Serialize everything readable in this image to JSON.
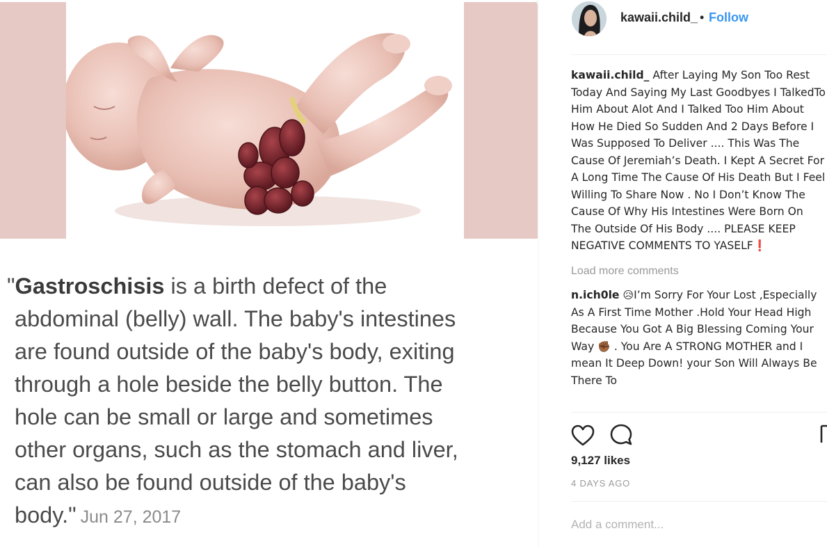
{
  "post": {
    "quote_word": "Gastroschisis",
    "quote_lines": [
      " is a birth defect of the",
      "abdominal (belly) wall. The baby's intestines",
      "are found outside of the baby's body, exiting",
      "through a hole beside the belly button. The",
      "hole can be small or large and sometimes",
      "other organs, such as the stomach and liver,",
      "can also be found outside of the baby's",
      "body.\""
    ],
    "quote_open": "\"",
    "quote_date": "Jun 27, 2017"
  },
  "header": {
    "username": "kawaii.child_",
    "separator": "•",
    "follow_label": "Follow"
  },
  "comments": {
    "caption": {
      "author": "kawaii.child_",
      "text": "After Laying My Son Too Rest Today And Saying My Last Goodbyes I TalkedTo Him About Alot And I Talked Too Him About How He Died So Sudden And 2 Days Before I Was Supposed To Deliver .... This Was The Cause Of Jeremiah’s Death. I Kept A Secret For A Long Time The Cause Of His Death But I Feel Willing To Share Now . No I Don’t Know The Cause Of Why His Intestines Were Born On The Outside Of His Body .... PLEASE KEEP NEGATIVE COMMENTS TO YASELF",
      "end_mark": "❗"
    },
    "load_more_label": "Load more comments",
    "items": [
      {
        "author": "n.ich0le",
        "emoji_1": "😥",
        "text_1": "I’m Sorry For Your Lost ,Especially As A First Time Mother .Hold Your Head High Because You Got A Big Blessing Coming Your Way ",
        "emoji_2": "✊🏾",
        "text_2": " . You Are A STRONG MOTHER and I mean It Deep Down! your Son Will Always Be There To"
      }
    ]
  },
  "actions": {
    "like_icon": "heart-outline-icon",
    "comment_icon": "comment-bubble-icon",
    "save_icon": "bookmark-icon"
  },
  "likes_text": "9,127 likes",
  "timestamp": "4 DAYS AGO",
  "add_comment_placeholder": "Add a comment...",
  "colors": {
    "link": "#3897f0",
    "image_bg": "#e6c9c4",
    "muted": "#999999"
  }
}
